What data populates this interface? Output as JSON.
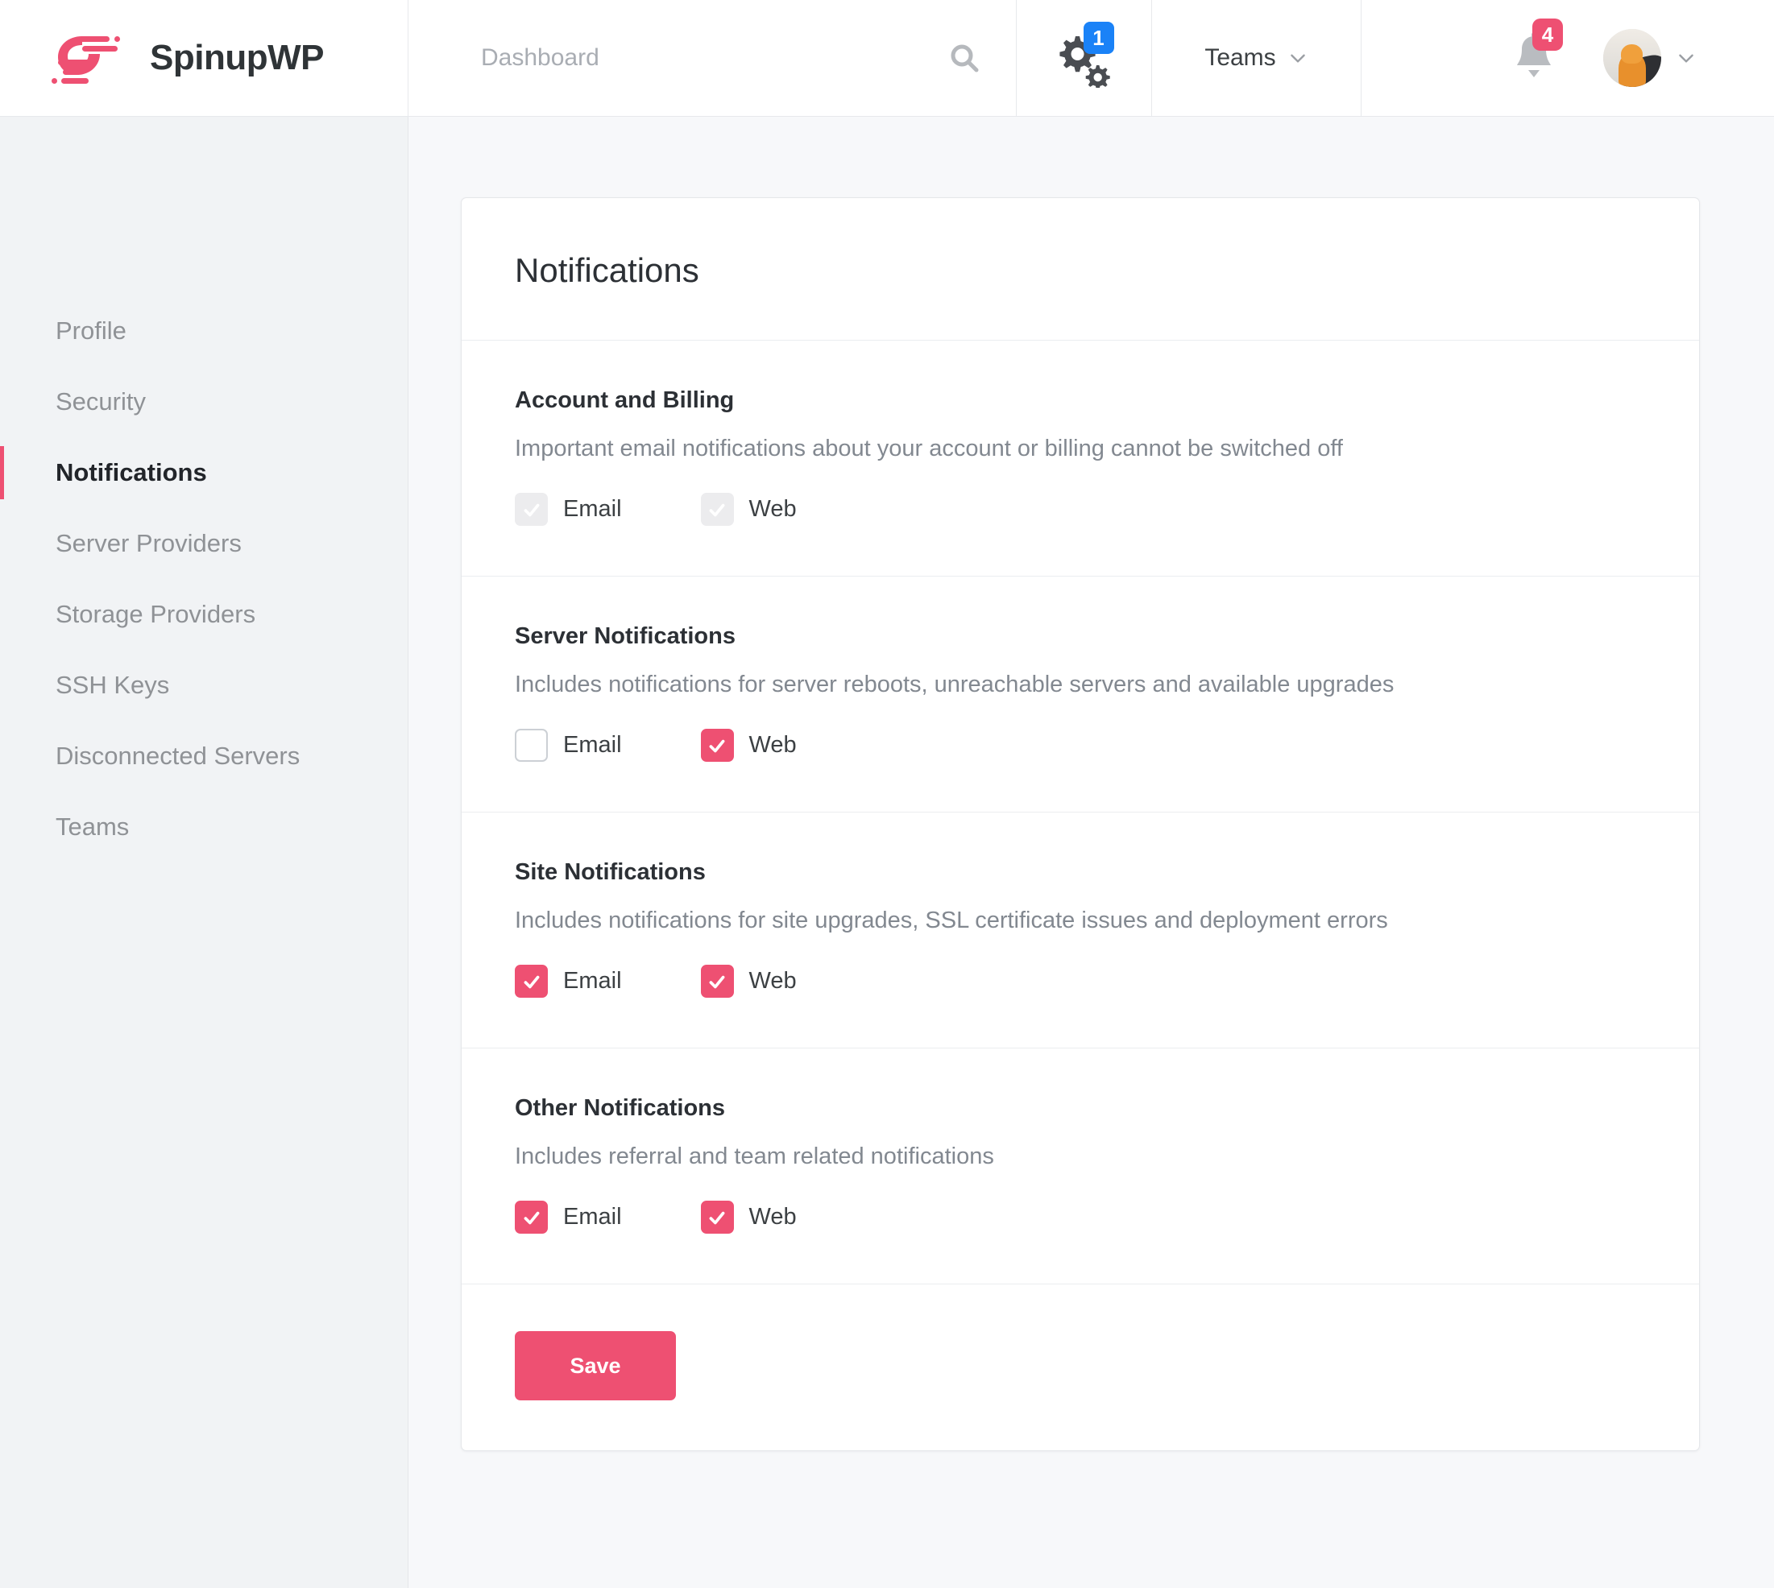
{
  "brand": {
    "name": "SpinupWP",
    "logo_icon": "spinupwp-speed-logo"
  },
  "topbar": {
    "search": {
      "placeholder": "Dashboard",
      "value": "",
      "icon": "search-icon"
    },
    "settings": {
      "icon": "gears-icon",
      "badge": "1",
      "badge_color": "#1a82f7"
    },
    "teams": {
      "label": "Teams",
      "chevron_icon": "chevron-down-icon"
    },
    "notifications": {
      "icon": "bell-icon",
      "badge": "4",
      "badge_color": "#ee5072"
    },
    "account": {
      "avatar_icon": "user-avatar",
      "chevron_icon": "chevron-down-icon"
    }
  },
  "sidebar": {
    "items": [
      {
        "label": "Profile",
        "active": false
      },
      {
        "label": "Security",
        "active": false
      },
      {
        "label": "Notifications",
        "active": true
      },
      {
        "label": "Server Providers",
        "active": false
      },
      {
        "label": "Storage Providers",
        "active": false
      },
      {
        "label": "SSH Keys",
        "active": false
      },
      {
        "label": "Disconnected Servers",
        "active": false
      },
      {
        "label": "Teams",
        "active": false
      }
    ]
  },
  "card": {
    "title": "Notifications",
    "sections": [
      {
        "title": "Account and Billing",
        "description": "Important email notifications about your account or billing cannot be switched off",
        "options": [
          {
            "label": "Email",
            "checked": true,
            "disabled": true
          },
          {
            "label": "Web",
            "checked": true,
            "disabled": true
          }
        ]
      },
      {
        "title": "Server Notifications",
        "description": "Includes notifications for server reboots, unreachable servers and available upgrades",
        "options": [
          {
            "label": "Email",
            "checked": false,
            "disabled": false
          },
          {
            "label": "Web",
            "checked": true,
            "disabled": false
          }
        ]
      },
      {
        "title": "Site Notifications",
        "description": "Includes notifications for site upgrades, SSL certificate issues and deployment errors",
        "options": [
          {
            "label": "Email",
            "checked": true,
            "disabled": false
          },
          {
            "label": "Web",
            "checked": true,
            "disabled": false
          }
        ]
      },
      {
        "title": "Other Notifications",
        "description": "Includes referral and team related notifications",
        "options": [
          {
            "label": "Email",
            "checked": true,
            "disabled": false
          },
          {
            "label": "Web",
            "checked": true,
            "disabled": false
          }
        ]
      }
    ],
    "save_label": "Save"
  },
  "colors": {
    "accent": "#ee5072",
    "badge_blue": "#1a82f7",
    "page_bg": "#f7f8fa",
    "sidebar_bg": "#f1f3f5"
  }
}
